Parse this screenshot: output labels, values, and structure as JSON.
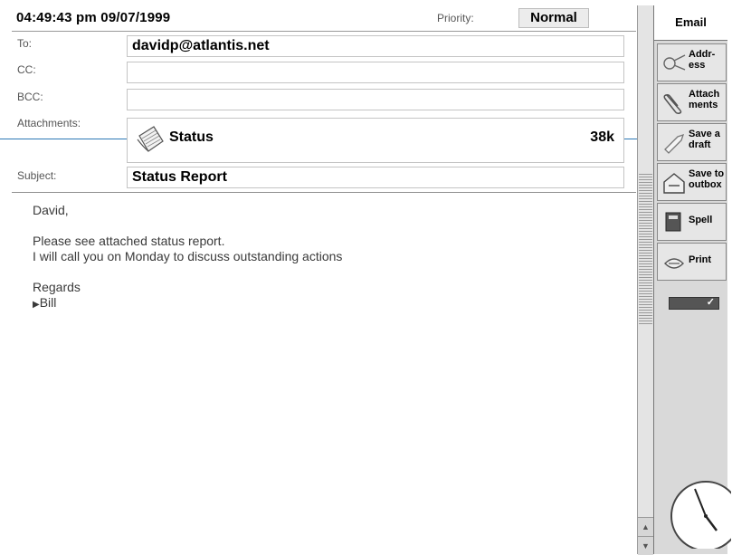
{
  "header": {
    "timestamp": "04:49:43 pm 09/07/1999",
    "priority_label": "Priority:",
    "priority_value": "Normal"
  },
  "fields": {
    "to_label": "To:",
    "to_value": "davidp@atlantis.net",
    "cc_label": "CC:",
    "cc_value": "",
    "bcc_label": "BCC:",
    "bcc_value": "",
    "attachments_label": "Attachments:",
    "attachment": {
      "name": "Status",
      "size": "38k",
      "icon": "document-icon"
    },
    "subject_label": "Subject:",
    "subject_value": "Status Report"
  },
  "body": {
    "text": "David,\n\nPlease see attached status report.\nI will call you on Monday to discuss outstanding actions\n\nRegards\n",
    "last_line": "Bill"
  },
  "toolbar": {
    "title": "Email",
    "buttons": [
      {
        "label": "Addr-\ness",
        "icon": "address-book-icon"
      },
      {
        "label": "Attach\nments",
        "icon": "paperclip-icon"
      },
      {
        "label": "Save a\ndraft",
        "icon": "save-draft-icon"
      },
      {
        "label": "Save to\noutbox",
        "icon": "outbox-icon"
      },
      {
        "label": "Spell",
        "icon": "spell-check-icon"
      },
      {
        "label": "Print",
        "icon": "print-icon"
      }
    ]
  },
  "colors": {
    "callout": "#2d77b5",
    "toolbar_bg": "#d9d9d9"
  }
}
